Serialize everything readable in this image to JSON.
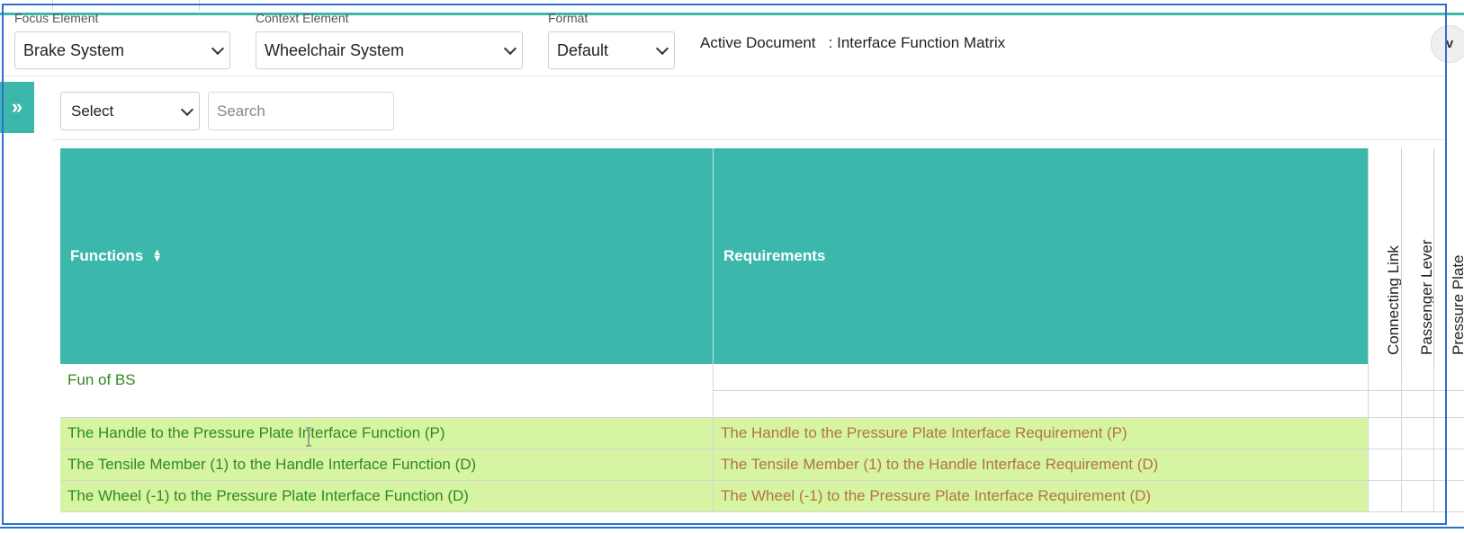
{
  "header": {
    "focus": {
      "label": "Focus Element",
      "value": "Brake System"
    },
    "context": {
      "label": "Context Element",
      "value": "Wheelchair System"
    },
    "format": {
      "label": "Format",
      "value": "Default"
    },
    "active_document": "Active Document   : Interface Function Matrix",
    "corner_button_text": "ᴠ"
  },
  "filters": {
    "select_value": "Select",
    "search_placeholder": "Search"
  },
  "table": {
    "headers": {
      "functions": "Functions",
      "requirements": "Requirements",
      "interfaces": [
        "Connecting Link",
        "Passenger Lever",
        "Pressure Plate"
      ]
    },
    "rows": [
      {
        "function": "Fun of BS",
        "requirements": [
          "",
          ""
        ],
        "highlighted": false
      },
      {
        "function": "The Handle to the Pressure Plate Interface Function (P)",
        "requirement": "The Handle to the Pressure Plate Interface Requirement (P)",
        "highlighted": true
      },
      {
        "function": "The Tensile Member (1) to the Handle Interface Function (D)",
        "requirement": "The Tensile Member (1) to the Handle Interface Requirement (D)",
        "highlighted": true
      },
      {
        "function": "The Wheel (-1) to the Pressure Plate Interface Function (D)",
        "requirement": "The Wheel (-1) to the Pressure Plate Interface Requirement (D)",
        "highlighted": true
      }
    ]
  },
  "colors": {
    "accent": "#3bb8ab",
    "highlight_row": "#d7f4a2",
    "function_text": "#2e8b1e",
    "requirement_text": "#b0763d",
    "frame": "#2d6fd1"
  },
  "icons": {
    "sidebar_toggle": "double-chevron-right-icon",
    "sort": "sort-icon",
    "dropdown": "chevron-down-icon"
  }
}
